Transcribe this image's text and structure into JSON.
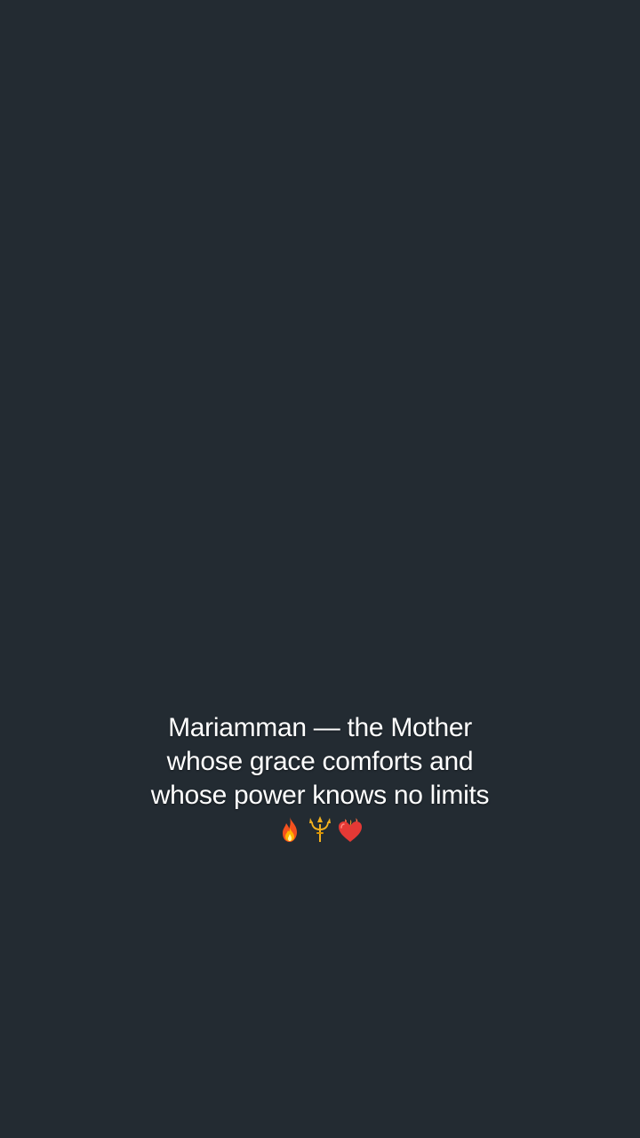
{
  "caption": {
    "lines": [
      "Mariamman — the Mother",
      "whose grace comforts and",
      "whose power knows no limits"
    ],
    "emojis": [
      "🔥",
      "🔱",
      "❤️‍🔥"
    ],
    "emoji_names": [
      "fire-icon",
      "trident-icon",
      "heart-on-fire-icon"
    ]
  },
  "colors": {
    "background": "#232b32",
    "text": "#ffffff"
  }
}
